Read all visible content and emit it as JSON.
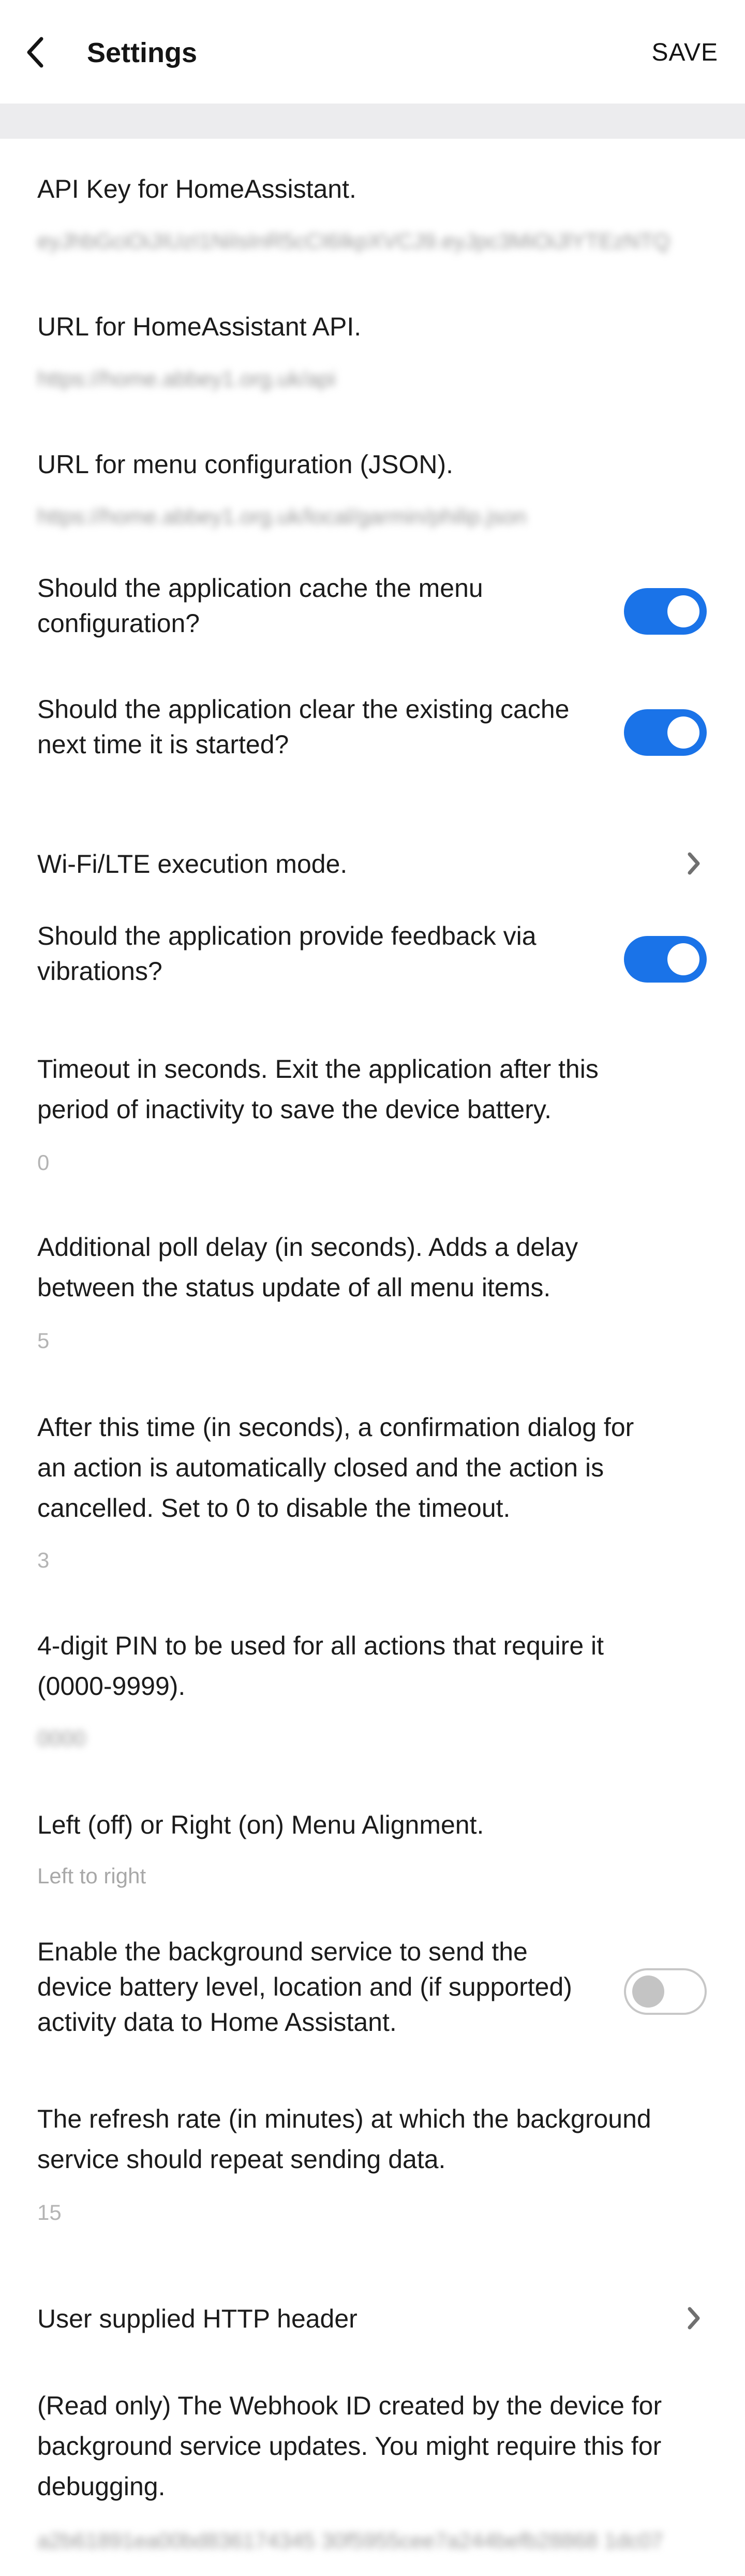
{
  "header": {
    "title": "Settings",
    "save_label": "SAVE"
  },
  "settings": {
    "api_key": {
      "label": "API Key for HomeAssistant.",
      "value": "eyJhbGciOiJIUzI1NiIsInR5cCI6IkpXVCJ9.eyJpc3MiOiJlYTEzNTQ"
    },
    "api_url": {
      "label": "URL for HomeAssistant API.",
      "value": "https://home.abbey1.org.uk/api"
    },
    "menu_url": {
      "label": "URL for menu configuration (JSON).",
      "value": "https://home.abbey1.org.uk/local/garmin/philip.json"
    },
    "cache_menu": {
      "line1": "Should the application cache the menu",
      "line2": "configuration?",
      "enabled": true
    },
    "clear_cache": {
      "line1": "Should the application clear the existing cache",
      "line2": "next time it is started?",
      "enabled": true
    },
    "wifi_mode": {
      "label": "Wi-Fi/LTE execution mode."
    },
    "vibrate": {
      "line1": "Should the application provide feedback via",
      "line2": "vibrations?",
      "enabled": true
    },
    "timeout": {
      "line1": "Timeout in seconds. Exit the application after this",
      "line2": "period of inactivity to save the device battery.",
      "value": "0"
    },
    "poll_delay": {
      "line1": "Additional poll delay (in seconds). Adds a delay",
      "line2": "between the status update of all menu items.",
      "value": "5"
    },
    "confirm_timeout": {
      "line1": "After this time (in seconds), a confirmation dialog for",
      "line2": "an action is automatically closed and the action is",
      "line3": "cancelled. Set to 0 to disable the timeout.",
      "value": "3"
    },
    "pin": {
      "line1": "4-digit PIN to be used for all actions that require it",
      "line2": "(0000-9999).",
      "value": "0000"
    },
    "alignment": {
      "label": "Left (off) or Right (on) Menu Alignment.",
      "value": "Left to right"
    },
    "background_service": {
      "line1": "Enable the background service to send the",
      "line2": "device battery level, location and (if supported)",
      "line3": "activity data to Home Assistant.",
      "enabled": false
    },
    "refresh_rate": {
      "line1": "The refresh rate (in minutes) at which the background",
      "line2": "service should repeat sending data.",
      "value": "15"
    },
    "http_header": {
      "label": "User supplied HTTP header"
    },
    "webhook": {
      "line1": "(Read only) The Webhook ID created by the device for",
      "line2": "background service updates. You might require this for",
      "line3": "debugging.",
      "value": "a2b61891ea00bd836174345 30f5955cee7a244befb28868 1dc07"
    }
  },
  "colors": {
    "accent": "#1a73e8",
    "section_band": "#ececee",
    "value_text": "#b4b4b4"
  },
  "icons": {
    "back": "chevron-left-icon",
    "nav": "chevron-right-icon"
  }
}
